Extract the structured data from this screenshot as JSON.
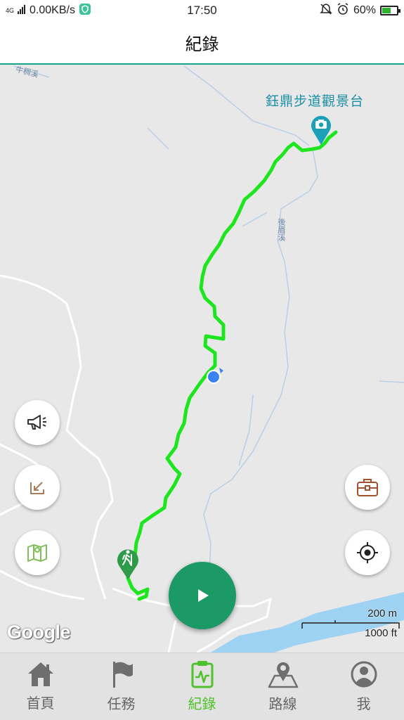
{
  "status_bar": {
    "signal": "4G",
    "network_speed": "0.00KB/s",
    "time": "17:50",
    "battery_text": "60%",
    "battery_level": 0.6
  },
  "header": {
    "title": "紀錄"
  },
  "map": {
    "poi_label": "鈺鼎步道觀景台",
    "river_labels": [
      "牛稠溪",
      "後眉溪"
    ],
    "google_logo": "Google",
    "scale_metric": "200 m",
    "scale_imperial": "1000 ft",
    "track_color": "#1ee61e",
    "poi_color": "#1aa0b8",
    "start_marker_color": "#2e9a4a",
    "location_color": "#3b82f0"
  },
  "buttons": {
    "announce": "megaphone-icon",
    "collapse": "arrow-down-left-icon",
    "map_layers": "map-icon",
    "toolbox": "briefcase-icon",
    "locate": "crosshair-icon",
    "record": "play-icon"
  },
  "nav": {
    "items": [
      {
        "label": "首頁",
        "icon": "home-icon"
      },
      {
        "label": "任務",
        "icon": "flag-icon"
      },
      {
        "label": "紀錄",
        "icon": "clipboard-icon",
        "active": true
      },
      {
        "label": "路線",
        "icon": "route-map-icon"
      },
      {
        "label": "我",
        "icon": "user-icon"
      }
    ],
    "active_color": "#4fc12a"
  }
}
